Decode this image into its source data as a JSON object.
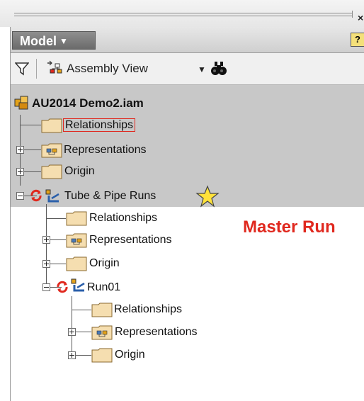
{
  "header": {
    "model_label": "Model",
    "help_label": "?"
  },
  "toolbar": {
    "view_label": "Assembly View"
  },
  "tree": {
    "root": "AU2014 Demo2.iam",
    "relationships_1": "Relationships",
    "representations_1": "Representations",
    "origin_1": "Origin",
    "tube_pipe": "Tube & Pipe Runs",
    "relationships_2": "Relationships",
    "representations_2": "Representations",
    "origin_2": "Origin",
    "run01": "Run01",
    "relationships_3": "Relationships",
    "representations_3": "Representations",
    "origin_3": "Origin"
  },
  "annotation": {
    "master_run": "Master Run",
    "color": "#e0281e"
  },
  "icons": [
    "close-icon",
    "chevron-down-icon",
    "help-icon",
    "filter-icon",
    "assembly-view-icon",
    "dropdown-arrow-icon",
    "find-binoculars-icon",
    "assembly-icon",
    "folder-icon",
    "representations-icon",
    "update-icon",
    "run-icon",
    "star-icon"
  ]
}
